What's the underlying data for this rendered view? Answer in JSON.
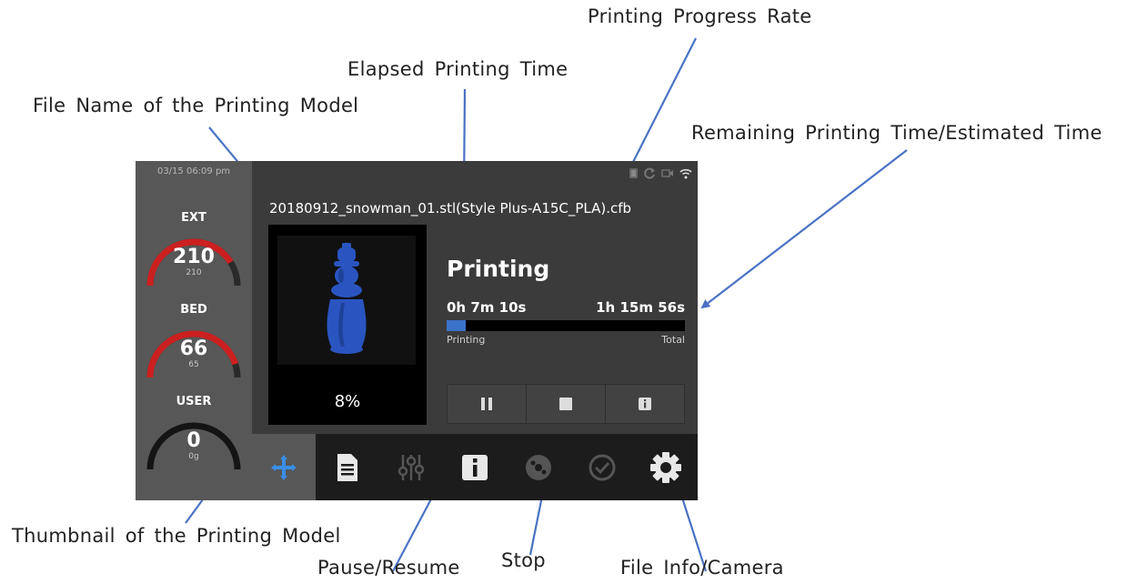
{
  "annotations": {
    "progress_rate": "Printing  Progress  Rate",
    "elapsed_time": "Elapsed  Printing  Time",
    "file_name": "File  Name  of  the  Printing  Model",
    "remaining_time": "Remaining  Printing  Time/Estimated  Time",
    "thumbnail": "Thumbnail  of  the  Printing  Model",
    "pause_resume": "Pause/Resume",
    "stop": "Stop",
    "file_info": "File Info/Camera"
  },
  "screen": {
    "datetime": "03/15 06:09 pm",
    "gauges": [
      {
        "label": "EXT",
        "value": "210",
        "sub": "210",
        "level": 0.82,
        "color": "#cc2020"
      },
      {
        "label": "BED",
        "value": "66",
        "sub": "65",
        "level": 0.9,
        "color": "#cc2020"
      },
      {
        "label": "USER",
        "value": "0",
        "sub": "0g",
        "level": 0.0,
        "color": "#111111"
      }
    ],
    "status_icons": [
      "battery-icon",
      "refresh-icon",
      "camera-icon",
      "wifi-icon"
    ],
    "file_name": "20180912_snowman_01.stl(Style Plus-A15C_PLA).cfb",
    "thumbnail_percent": "8%",
    "status": "Printing",
    "elapsed": "0h 7m 10s",
    "remaining": "1h 15m 56s",
    "progress": 0.08,
    "progress_label_left": "Printing",
    "progress_label_right": "Total",
    "controls": [
      "pause-icon",
      "stop-icon",
      "info-icon"
    ],
    "nav_items": [
      "move-icon",
      "file-icon",
      "tune-icon",
      "info-icon",
      "material-icon",
      "check-icon",
      "settings-icon"
    ],
    "colors": {
      "accent": "#3a73c9",
      "model": "#2a55c0",
      "gauge_hot": "#cc2020"
    }
  }
}
